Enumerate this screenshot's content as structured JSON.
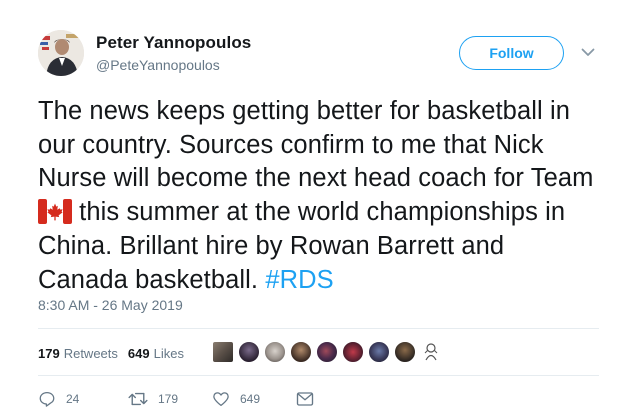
{
  "author": {
    "name": "Peter Yannopoulos",
    "handle": "@PeteYannopoulos"
  },
  "follow_label": "Follow",
  "tweet": {
    "text_part1": "The news keeps getting better for basketball in our country. Sources confirm to me that Nick Nurse will become the next head coach for Team ",
    "text_part2": " this summer at the world championships in China. Brillant hire by Rowan Barrett and Canada basketball. ",
    "hashtag": "#RDS",
    "timestamp": "8:30 AM - 26 May 2019"
  },
  "stats": {
    "retweets_count": "179",
    "retweets_label": "Retweets",
    "likes_count": "649",
    "likes_label": "Likes"
  },
  "actions": {
    "reply_count": "24",
    "retweet_count": "179",
    "like_count": "649"
  },
  "icons": {
    "flag": "canada-flag-icon",
    "caret": "chevron-down-icon",
    "reply": "reply-icon",
    "retweet": "retweet-icon",
    "like": "heart-icon",
    "message": "envelope-icon"
  },
  "colors": {
    "accent": "#1da1f2",
    "text": "#14171a",
    "muted": "#657786",
    "divider": "#e6ecf0",
    "flag_red": "#d52b1e"
  }
}
